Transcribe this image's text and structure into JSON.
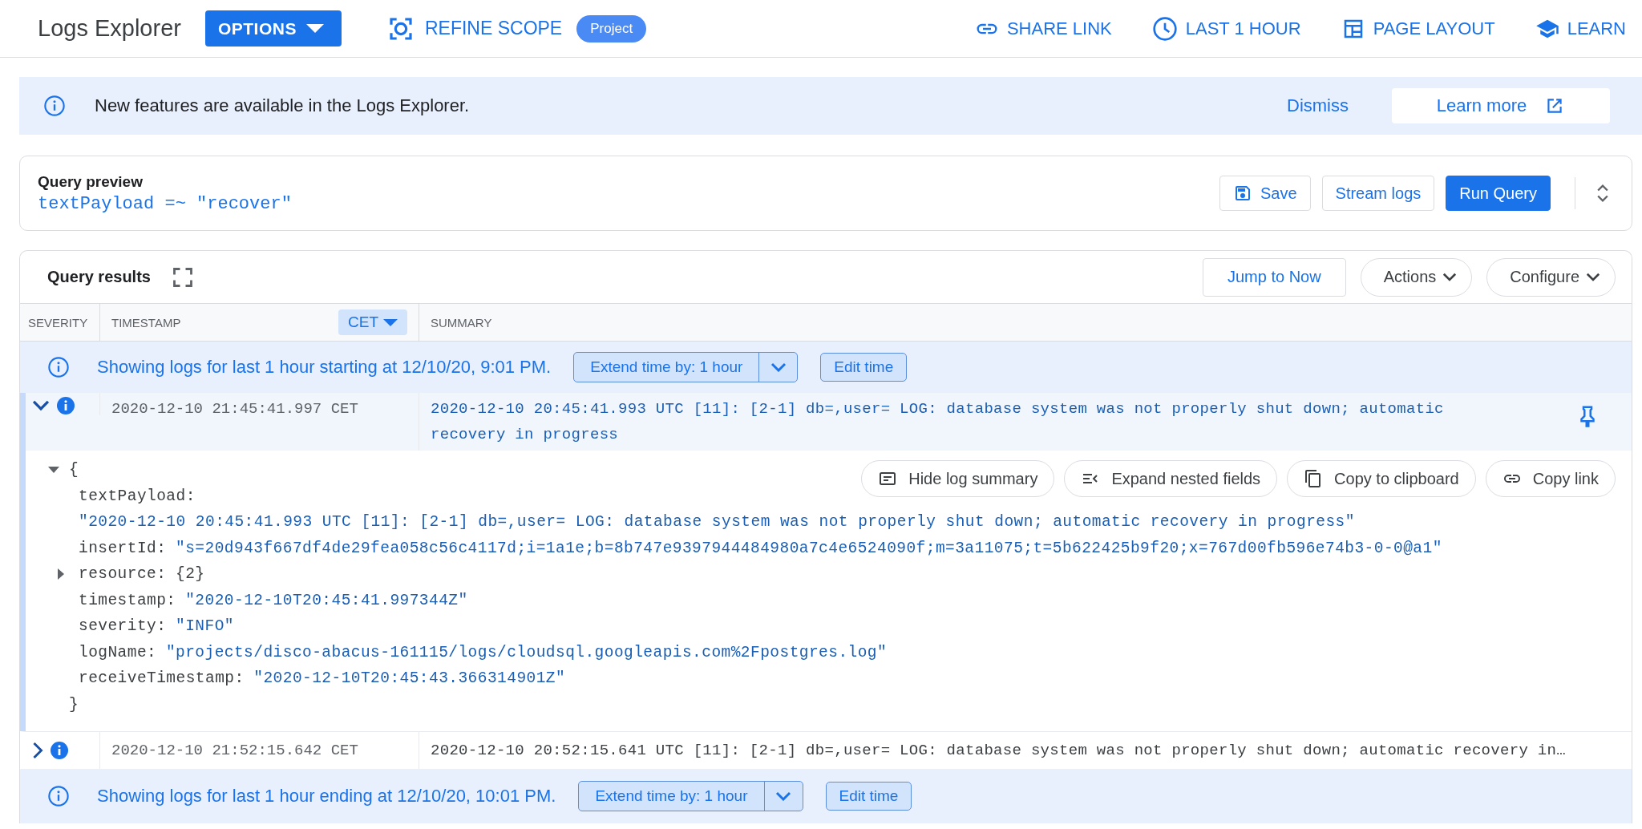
{
  "topbar": {
    "title": "Logs Explorer",
    "options_button": "OPTIONS",
    "refine_scope": "REFINE SCOPE",
    "scope_badge": "Project",
    "actions": [
      {
        "kind": "link",
        "label": "SHARE LINK"
      },
      {
        "kind": "clock",
        "label": "LAST 1 HOUR"
      },
      {
        "kind": "layout",
        "label": "PAGE LAYOUT"
      },
      {
        "kind": "school",
        "label": "LEARN"
      }
    ]
  },
  "banner": {
    "message": "New features are available in the Logs Explorer.",
    "dismiss": "Dismiss",
    "learn_more": "Learn more"
  },
  "query_preview": {
    "title": "Query preview",
    "query": "textPayload =~ \"recover\"",
    "buttons": [
      {
        "kind": "save",
        "label": "Save"
      },
      {
        "kind": "outline",
        "label": "Stream logs"
      },
      {
        "kind": "primary",
        "label": "Run Query"
      }
    ]
  },
  "query_results": {
    "title": "Query results",
    "buttons": [
      {
        "kind": "outline",
        "label": "Jump to Now"
      },
      {
        "kind": "menu",
        "label": "Actions"
      },
      {
        "kind": "menu",
        "label": "Configure"
      }
    ],
    "columns": [
      {
        "label": "SEVERITY"
      },
      {
        "label": "TIMESTAMP",
        "timezone": "CET"
      },
      {
        "label": "SUMMARY"
      }
    ],
    "rows": [
      {
        "kind": "notice",
        "text": "Showing logs for last 1 hour starting at 12/10/20, 9:01 PM.",
        "extend": "Extend time by: 1 hour",
        "edit": "Edit time"
      },
      {
        "kind": "log",
        "expanded": true,
        "timestamp": "2020-12-10 21:45:41.997 CET",
        "summary": "2020-12-10 20:45:41.993 UTC [11]: [2-1] db=,user= LOG:  database system was not properly shut down; automatic recovery in progress",
        "detail": {
          "open_brace": "{",
          "close_brace": "}",
          "actions": [
            {
              "kind": "summary",
              "label": "Hide log summary"
            },
            {
              "kind": "expand",
              "label": "Expand nested fields"
            },
            {
              "kind": "copy",
              "label": "Copy to clipboard"
            },
            {
              "kind": "link",
              "label": "Copy link"
            }
          ],
          "fields": [
            {
              "kind": "block",
              "key": "textPayload:",
              "value": "\"2020-12-10 20:45:41.993 UTC [11]: [2-1] db=,user= LOG:  database system was not properly shut down; automatic recovery in progress\""
            },
            {
              "kind": "pair",
              "key": "insertId:",
              "value": "\"s=20d943f667df4de29fea058c56c4117d;i=1a1e;b=8b747e9397944484980a7c4e6524090f;m=3a11075;t=5b622425b9f20;x=767d00fb596e74b3-0-0@a1\""
            },
            {
              "kind": "collapsed",
              "key": "resource:",
              "value": "{2}",
              "expanded": false
            },
            {
              "kind": "pair",
              "key": "timestamp:",
              "value": "\"2020-12-10T20:45:41.997344Z\""
            },
            {
              "kind": "pair",
              "key": "severity:",
              "value": "\"INFO\""
            },
            {
              "kind": "pair",
              "key": "logName:",
              "value": "\"projects/disco-abacus-161115/logs/cloudsql.googleapis.com%2Fpostgres.log\""
            },
            {
              "kind": "pair",
              "key": "receiveTimestamp:",
              "value": "\"2020-12-10T20:45:43.366314901Z\""
            }
          ]
        }
      },
      {
        "kind": "log",
        "expanded": false,
        "timestamp": "2020-12-10 21:52:15.642 CET",
        "summary": "2020-12-10 20:52:15.641 UTC [11]: [2-1] db=,user= LOG: database system was not properly shut down; automatic recovery in…"
      },
      {
        "kind": "notice",
        "text": "Showing logs for last 1 hour ending at 12/10/20, 10:01 PM.",
        "extend": "Extend time by: 1 hour",
        "edit": "Edit time"
      }
    ]
  }
}
